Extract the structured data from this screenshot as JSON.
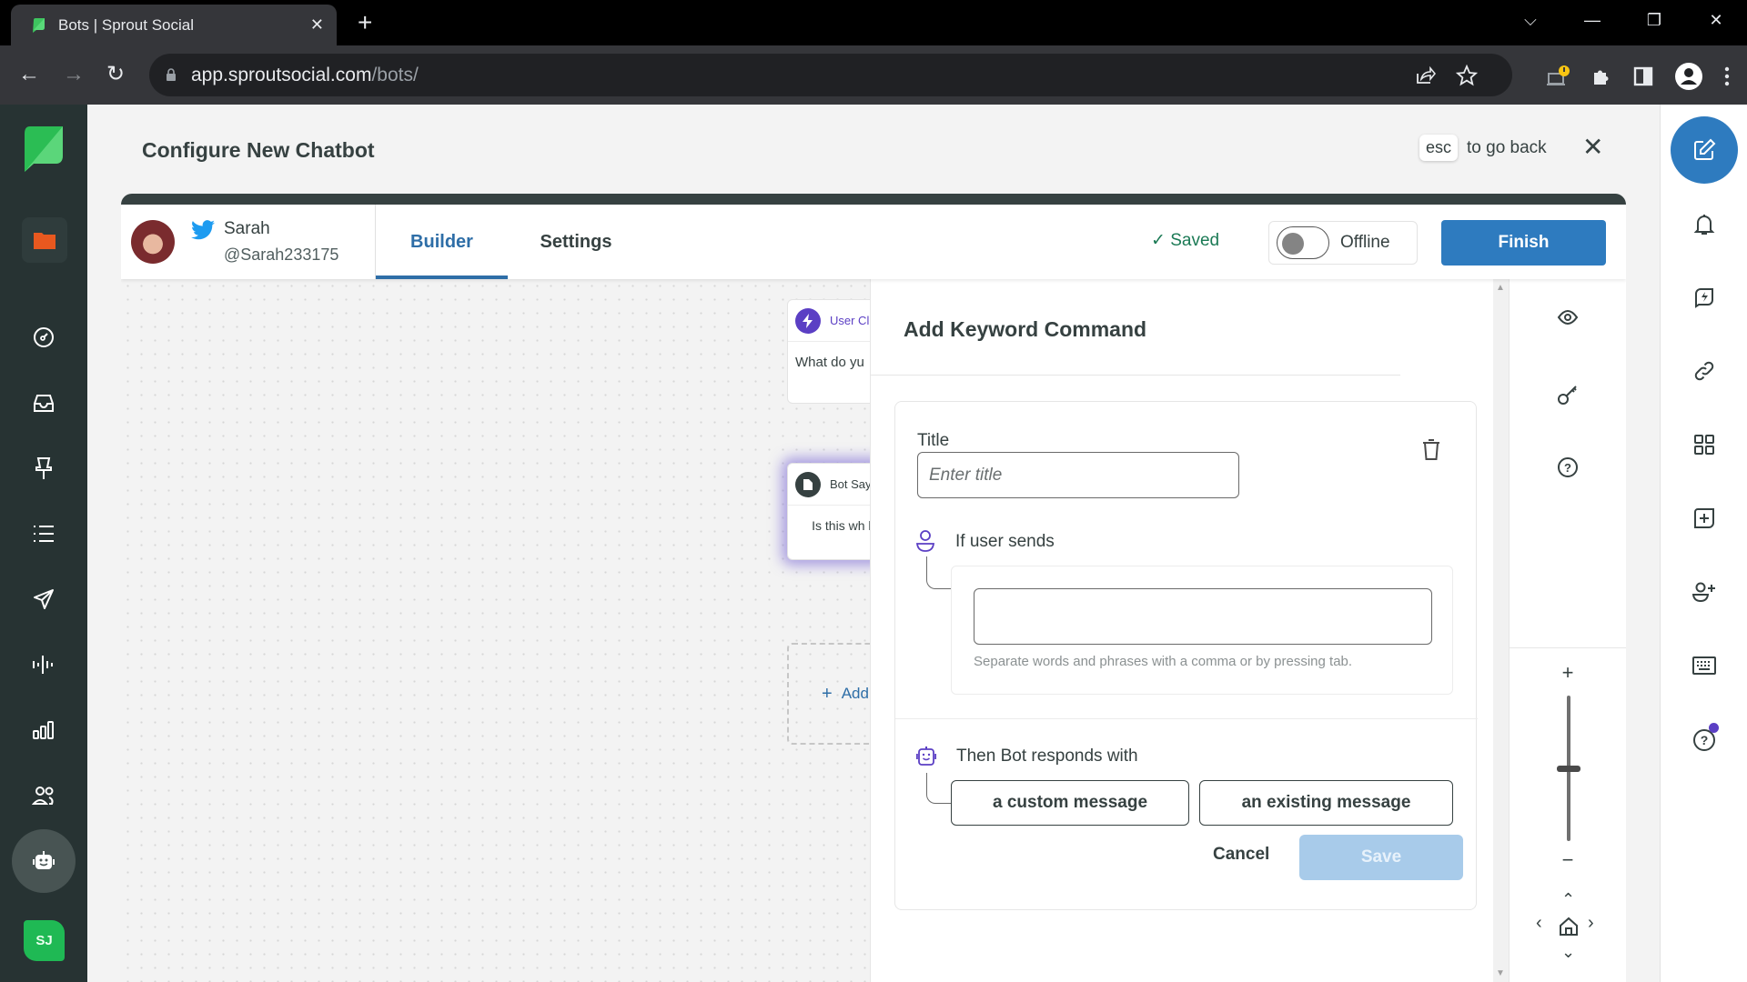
{
  "browser": {
    "tab_title": "Bots | Sprout Social",
    "url_host": "app.sproutsocial.com",
    "url_path": "/bots/"
  },
  "header": {
    "title": "Configure New Chatbot",
    "esc_key": "esc",
    "esc_hint": "to go back"
  },
  "leftnav": {
    "items": [
      {
        "icon": "folder-icon"
      },
      {
        "icon": "dashboard-icon"
      },
      {
        "icon": "inbox-icon"
      },
      {
        "icon": "pin-icon"
      },
      {
        "icon": "list-icon"
      },
      {
        "icon": "send-icon"
      },
      {
        "icon": "listening-icon"
      },
      {
        "icon": "reports-icon"
      },
      {
        "icon": "people-icon"
      },
      {
        "icon": "bot-icon",
        "active": true
      }
    ],
    "user_initials": "SJ"
  },
  "account": {
    "name": "Sarah",
    "handle": "@Sarah233175",
    "network": "twitter"
  },
  "tabs": [
    {
      "label": "Builder",
      "active": true
    },
    {
      "label": "Settings",
      "active": false
    }
  ],
  "status": {
    "saved_label": "Saved",
    "toggle_label": "Offline",
    "online": false
  },
  "finish_label": "Finish",
  "canvas": {
    "nodes": [
      {
        "type": "User Choice",
        "title": "User Cl",
        "body": "What do yu"
      },
      {
        "type": "Bot Says",
        "title": "Bot Say",
        "body": "Is this wh lookir"
      }
    ],
    "add_label": "Add"
  },
  "panel": {
    "title": "Add Keyword Command",
    "title_label": "Title",
    "title_placeholder": "Enter title",
    "title_value": "",
    "if_user_sends_label": "If user sends",
    "keywords_value": "",
    "keywords_helper": "Separate words and phrases with a comma or by pressing tab.",
    "then_label": "Then Bot responds with",
    "custom_message_label": "a custom message",
    "existing_message_label": "an existing message",
    "cancel_label": "Cancel",
    "save_label": "Save"
  },
  "tools": {
    "items": [
      "eye-icon",
      "key-icon",
      "help-icon"
    ],
    "zoom_plus": "+",
    "zoom_minus": "−",
    "zoom_level": 0.5
  },
  "rightnav": {
    "items": [
      "compose-icon",
      "bell-icon",
      "quick-reply-icon",
      "link-icon",
      "apps-icon",
      "add-task-icon",
      "add-user-icon",
      "keyboard-icon",
      "help-icon"
    ],
    "help_has_notification": true
  },
  "colors": {
    "brand_green": "#1fb954",
    "primary_blue": "#2e7bbf",
    "nav_dark": "#273333",
    "accent_purple": "#5b3fc4",
    "saved_green": "#1b7a55"
  }
}
